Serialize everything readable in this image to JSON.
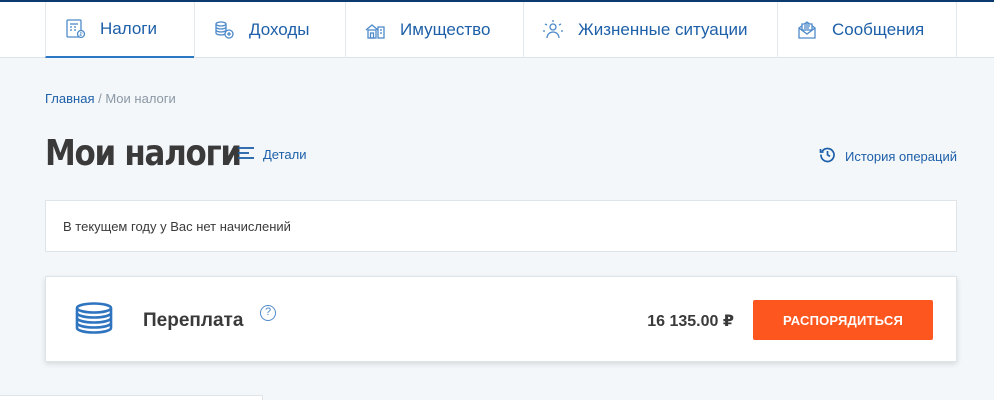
{
  "nav": {
    "tabs": [
      {
        "label": "Налоги",
        "icon": "tax-calculator-icon",
        "active": true
      },
      {
        "label": "Доходы",
        "icon": "coins-stack-icon",
        "active": false
      },
      {
        "label": "Имущество",
        "icon": "property-icon",
        "active": false
      },
      {
        "label": "Жизненные ситуации",
        "icon": "life-situations-icon",
        "active": false
      },
      {
        "label": "Сообщения",
        "icon": "envelope-icon",
        "active": false
      }
    ]
  },
  "breadcrumb": {
    "home": "Главная",
    "separator": " / ",
    "current": "Мои налоги"
  },
  "page": {
    "title": "Мои налоги",
    "details_label": "Детали",
    "history_label": "История операций"
  },
  "notice": {
    "text": "В текущем году у Вас нет начислений"
  },
  "overpayment": {
    "label": "Переплата",
    "help": "?",
    "amount": "16 135.00 ₽",
    "button_label": "РАСПОРЯДИТЬСЯ"
  },
  "colors": {
    "accent": "#1d5fa8",
    "button": "#fd561f",
    "background": "#f3f7fa"
  }
}
